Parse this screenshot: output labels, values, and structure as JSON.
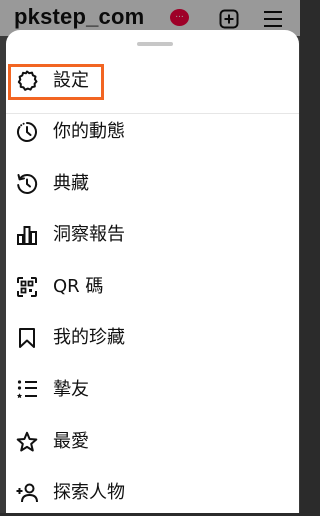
{
  "header": {
    "username": "pkstep_com",
    "notification_badge": "..."
  },
  "menu": {
    "items": [
      {
        "label": "設定",
        "icon": "settings-gear-icon"
      },
      {
        "label": "你的動態",
        "icon": "activity-clock-icon"
      },
      {
        "label": "典藏",
        "icon": "archive-history-icon"
      },
      {
        "label": "洞察報告",
        "icon": "insights-bar-chart-icon"
      },
      {
        "label": "QR 碼",
        "icon": "qr-code-icon"
      },
      {
        "label": "我的珍藏",
        "icon": "bookmark-icon"
      },
      {
        "label": "摯友",
        "icon": "close-friends-list-icon"
      },
      {
        "label": "最愛",
        "icon": "star-icon"
      },
      {
        "label": "探索人物",
        "icon": "add-person-icon"
      }
    ]
  },
  "colors": {
    "highlight": "#f26522",
    "notification": "#ff0040"
  }
}
